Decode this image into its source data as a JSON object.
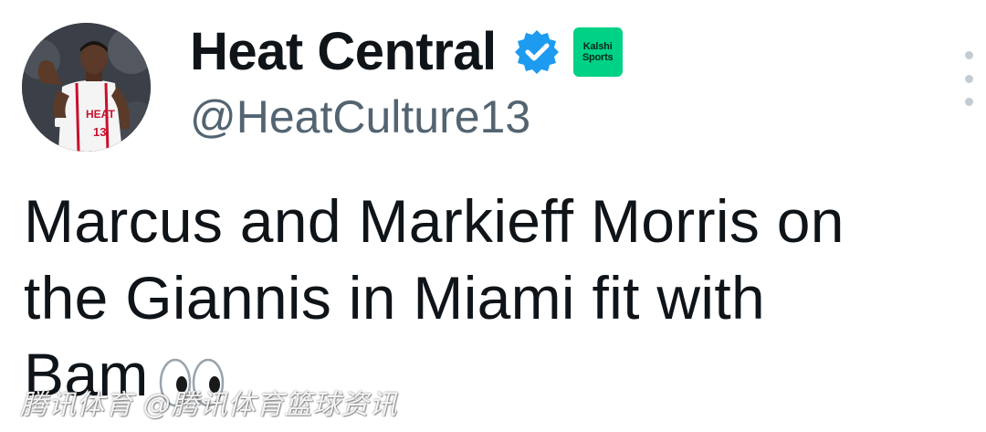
{
  "author": {
    "display_name": "Heat Central",
    "handle": "@HeatCulture13",
    "verified_icon": "verified-badge-icon",
    "verified_color": "#1d9bf0",
    "affiliate_badge": {
      "line1": "Kalshi",
      "line2": "Sports",
      "color": "#00d285"
    },
    "avatar_icon": "player-avatar-icon"
  },
  "menu": {
    "icon": "more-vertical-icon"
  },
  "tweet": {
    "lines": [
      "Marcus and Markieff Morris on",
      "the Giannis in Miami fit with",
      "Bam"
    ],
    "emoji": "eyes-emoji"
  },
  "watermark": {
    "text": "腾讯体育 @腾讯体育篮球资讯"
  },
  "colors": {
    "text_primary": "#0f1419",
    "text_secondary": "#536471",
    "menu_dots": "#c4ccd3"
  }
}
